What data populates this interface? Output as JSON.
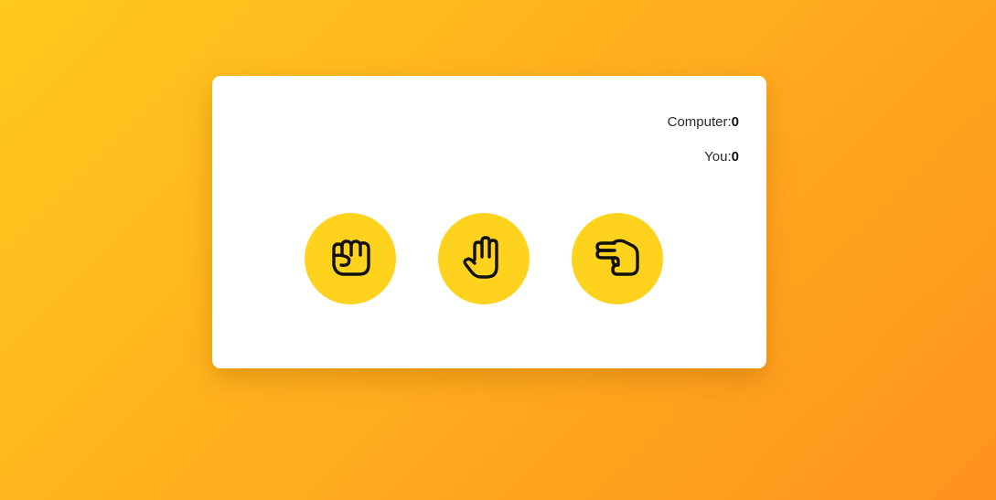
{
  "scoreboard": {
    "computer_label": "Computer:",
    "computer_score": "0",
    "you_label": "You:",
    "you_score": "0"
  },
  "choices": [
    {
      "name": "rock",
      "icon": "fist-icon"
    },
    {
      "name": "paper",
      "icon": "open-hand-icon"
    },
    {
      "name": "scissors",
      "icon": "scissors-hand-icon"
    }
  ],
  "colors": {
    "background_start": "#ffc81d",
    "background_end": "#ff931e",
    "card": "#ffffff",
    "choice_button": "#ffd31d",
    "icon_stroke": "#111111"
  }
}
